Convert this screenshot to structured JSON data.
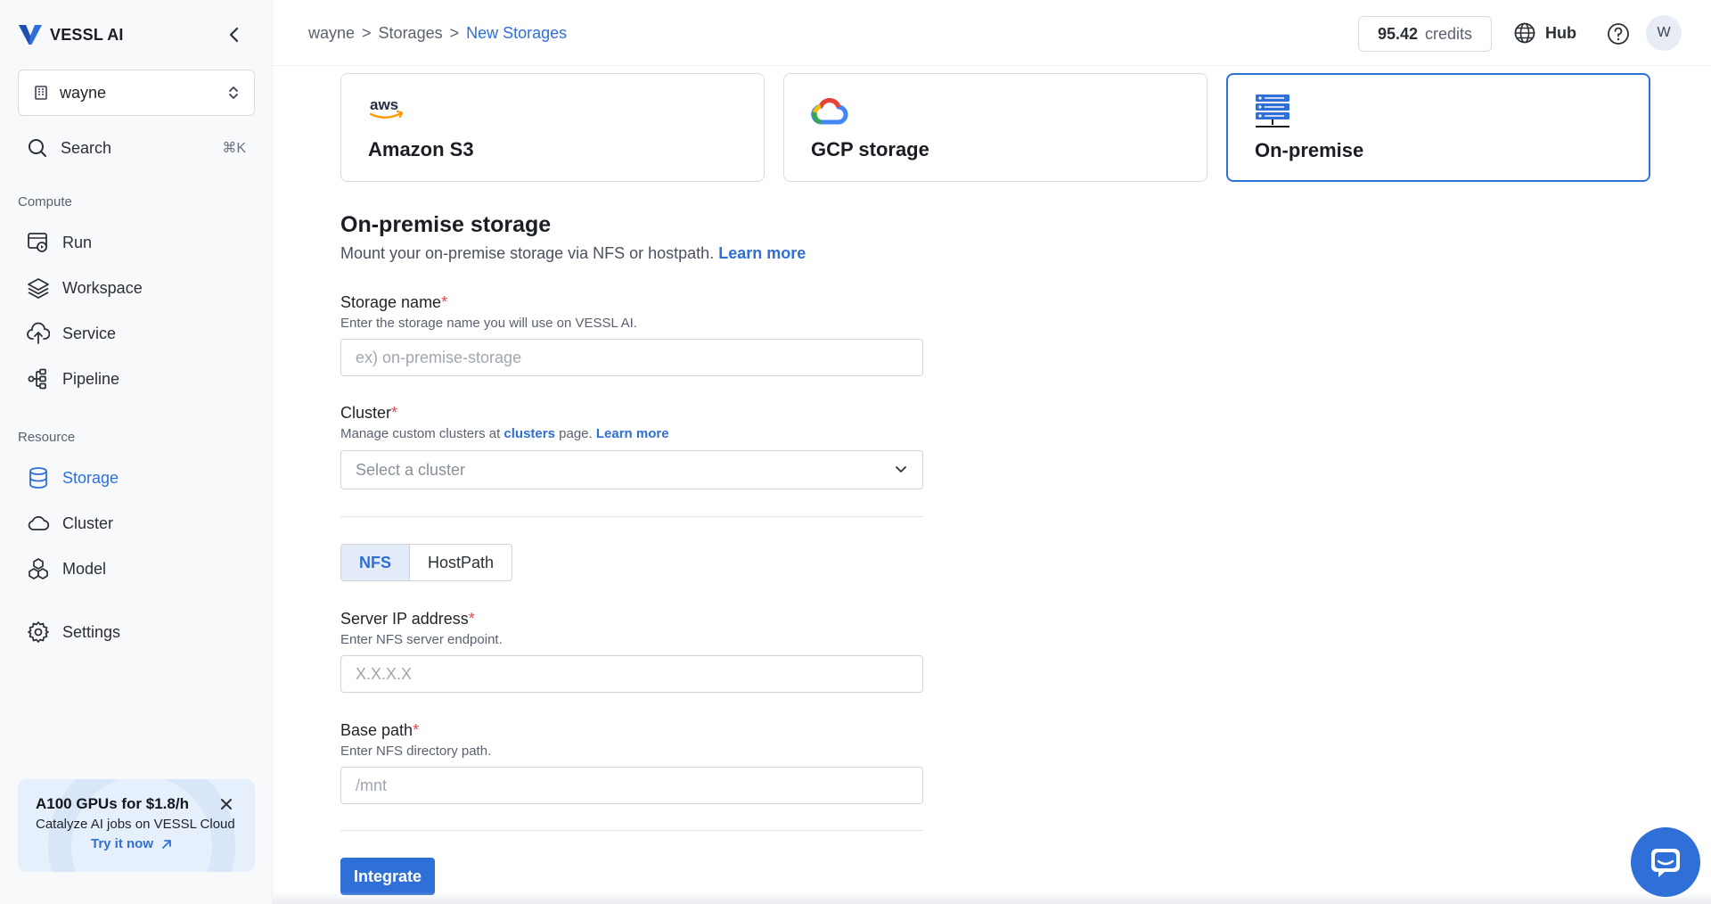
{
  "brand": {
    "name": "VESSL AI"
  },
  "org": {
    "name": "wayne"
  },
  "search": {
    "label": "Search",
    "shortcut": "⌘K"
  },
  "sidebar": {
    "sections": [
      {
        "label": "Compute"
      },
      {
        "label": "Resource"
      }
    ],
    "compute_items": [
      {
        "label": "Run",
        "icon": "run-icon"
      },
      {
        "label": "Workspace",
        "icon": "layers-icon"
      },
      {
        "label": "Service",
        "icon": "cloud-upload-icon"
      },
      {
        "label": "Pipeline",
        "icon": "pipeline-icon"
      }
    ],
    "resource_items": [
      {
        "label": "Storage",
        "icon": "database-icon",
        "active": true
      },
      {
        "label": "Cluster",
        "icon": "cloud-icon"
      },
      {
        "label": "Model",
        "icon": "model-icon"
      }
    ],
    "settings": {
      "label": "Settings",
      "icon": "gear-icon"
    }
  },
  "promo": {
    "title": "A100 GPUs for $1.8/h",
    "description": "Catalyze AI jobs on VESSL Cloud",
    "cta": "Try it now"
  },
  "header": {
    "breadcrumb": [
      "wayne",
      ">",
      "Storages",
      ">",
      "New Storages"
    ],
    "credits_value": "95.42",
    "credits_unit": "credits",
    "hub_label": "Hub",
    "avatar_initial": "W"
  },
  "providers": [
    {
      "label": "Amazon S3",
      "logo": "aws-logo"
    },
    {
      "label": "GCP storage",
      "logo": "gcp-logo"
    },
    {
      "label": "On-premise",
      "logo": "server-rack-icon",
      "selected": true
    }
  ],
  "form": {
    "title": "On-premise storage",
    "description": "Mount your on-premise storage via NFS or hostpath.",
    "description_link": "Learn more",
    "storage_name": {
      "label": "Storage name",
      "required": "*",
      "help": "Enter the storage name you will use on VESSL AI.",
      "placeholder": "ex) on-premise-storage",
      "value": ""
    },
    "cluster": {
      "label": "Cluster",
      "required": "*",
      "help_prefix": "Manage custom clusters at",
      "help_link1": "clusters",
      "help_mid": "page.",
      "help_link2": "Learn more",
      "placeholder": "Select a cluster"
    },
    "mount_types": [
      {
        "label": "NFS",
        "active": true
      },
      {
        "label": "HostPath",
        "active": false
      }
    ],
    "server_ip": {
      "label": "Server IP address",
      "required": "*",
      "help": "Enter NFS server endpoint.",
      "placeholder": "X.X.X.X",
      "value": ""
    },
    "base_path": {
      "label": "Base path",
      "required": "*",
      "help": "Enter NFS directory path.",
      "placeholder": "/mnt",
      "value": ""
    },
    "submit_label": "Integrate"
  },
  "colors": {
    "accent": "#2f6fd8",
    "required": "#e5484d",
    "sidebar_bg": "#f8f9fb"
  }
}
